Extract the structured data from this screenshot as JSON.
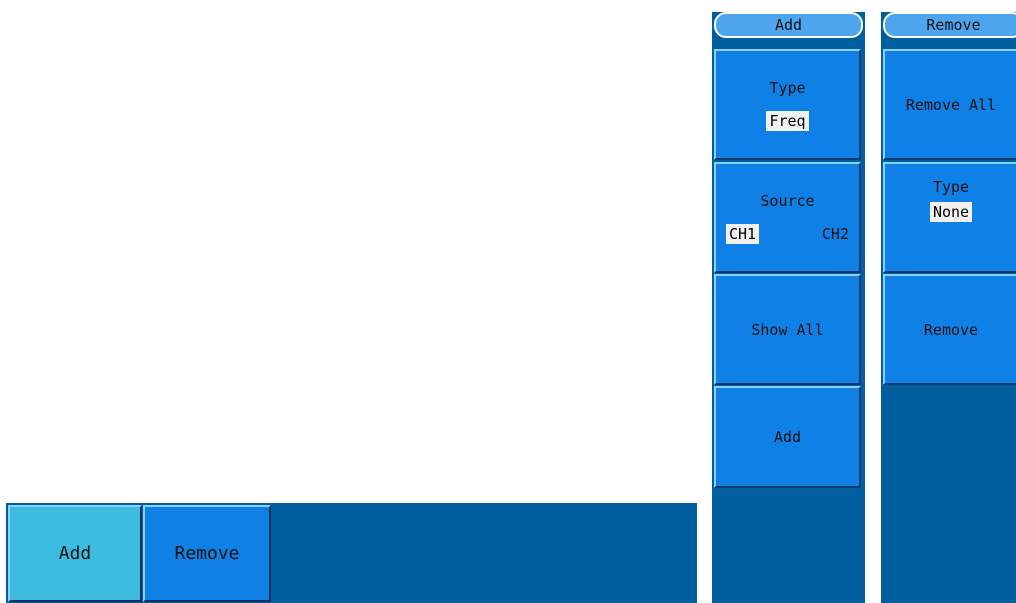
{
  "bottom_menu": {
    "add_label": "Add",
    "remove_label": "Remove"
  },
  "add_panel": {
    "header": "Add",
    "type_label": "Type",
    "type_value": "Freq",
    "source_label": "Source",
    "source_ch1": "CH1",
    "source_ch2": "CH2",
    "show_all_label": "Show All",
    "add_label": "Add"
  },
  "remove_panel": {
    "header": "Remove",
    "remove_all_label": "Remove All",
    "type_label": "Type",
    "type_value": "None",
    "remove_label": "Remove"
  },
  "colors": {
    "panel_background": "#005f9f",
    "button_blue": "#0f80e6",
    "button_active_cyan": "#3cbde0",
    "value_highlight": "#f1f1f1"
  }
}
